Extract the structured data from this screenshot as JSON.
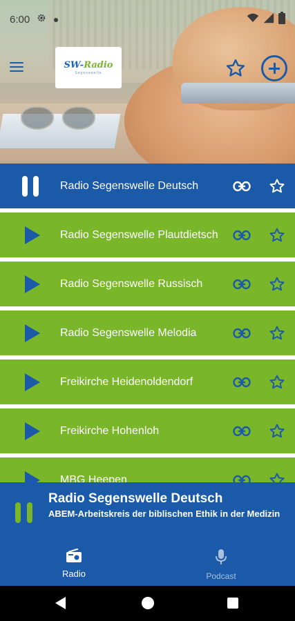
{
  "status_bar": {
    "time": "6:00"
  },
  "header": {
    "logo": {
      "brand_main": "SW-",
      "brand_accent": "Radio",
      "brand_sub": "Segenswelle"
    }
  },
  "stations": [
    {
      "name": "Radio Segenswelle Deutsch",
      "state": "playing"
    },
    {
      "name": "Radio Segenswelle Plautdietsch",
      "state": "stopped"
    },
    {
      "name": "Radio Segenswelle Russisch",
      "state": "stopped"
    },
    {
      "name": "Radio Segenswelle Melodia",
      "state": "stopped"
    },
    {
      "name": "Freikirche Heidenoldendorf",
      "state": "stopped"
    },
    {
      "name": "Freikirche Hohenloh",
      "state": "stopped"
    },
    {
      "name": "MBG Heepen",
      "state": "stopped"
    }
  ],
  "now_playing": {
    "station": "Radio Segenswelle Deutsch",
    "track": "ABEM-Arbeitskreis der biblischen Ethik in der Medizin"
  },
  "bottom_nav": {
    "radio_label": "Radio",
    "podcast_label": "Podcast"
  },
  "colors": {
    "primary_blue": "#1b5aa8",
    "accent_green": "#79b62a",
    "white": "#ffffff"
  }
}
